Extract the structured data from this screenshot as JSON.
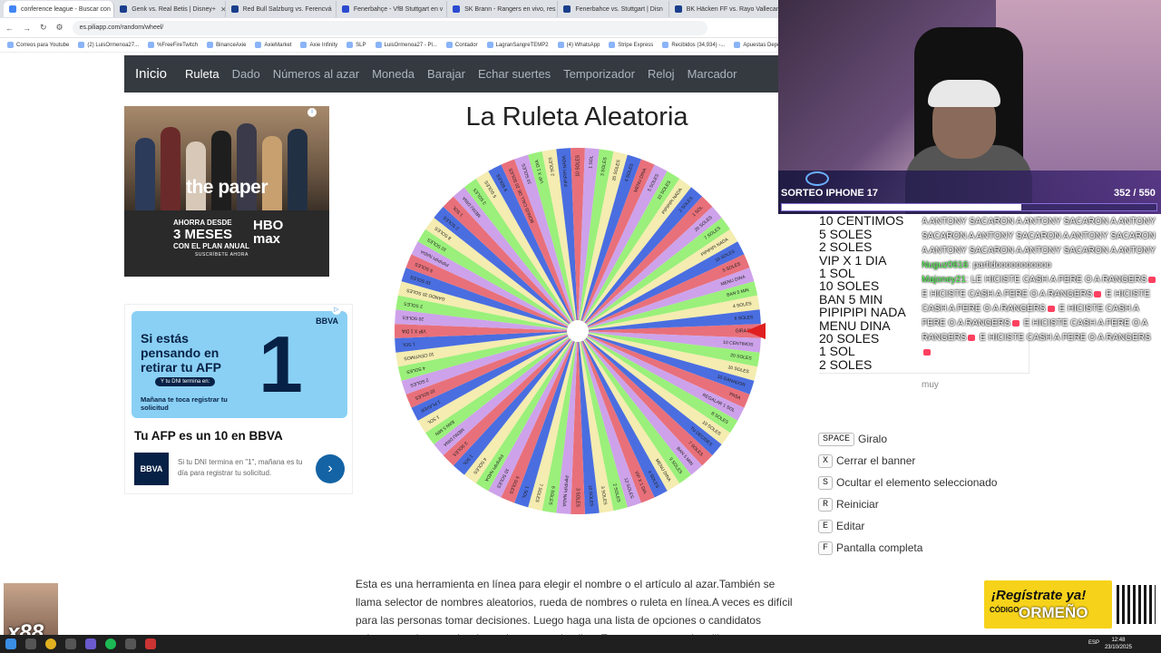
{
  "browser": {
    "tabs": [
      {
        "label": "conference league - Buscar con",
        "color": "#4285f4"
      },
      {
        "label": "Genk vs. Real Betis | Disney+",
        "color": "#1a3e8c"
      },
      {
        "label": "Red Bull Salzburg vs. Ferencvá",
        "color": "#1a3e8c"
      },
      {
        "label": "Fenerbahçe - VfB Stuttgart en v",
        "color": "#2b4ad1"
      },
      {
        "label": "SK Brann - Rangers en vivo, res",
        "color": "#2b4ad1"
      },
      {
        "label": "Fenerbahce vs. Stuttgart | Disn",
        "color": "#1a3e8c"
      },
      {
        "label": "BK Häcken FF vs. Rayo Vallecan",
        "color": "#1a3e8c"
      }
    ],
    "url": "es.piliapp.com/random/wheel/",
    "bookmarks": [
      "Correos para Youtube",
      "(2) LuisOrmenoa27...",
      "%FreeFireTwitch",
      "BinanceAxie",
      "AxieMarket",
      "Axie Infinity",
      "SLP",
      "LuisOrmenoa27 - Pl...",
      "Contador",
      "LagranSangreTEMP2",
      "(4) WhatsApp",
      "Stripe Express",
      "Recibidos (34,934) -...",
      "Apuestas Depo"
    ]
  },
  "nav": {
    "brand": "Inicio",
    "links": [
      "Ruleta",
      "Dado",
      "Números al azar",
      "Moneda",
      "Barajar",
      "Echar suertes",
      "Temporizador",
      "Reloj",
      "Marcador"
    ]
  },
  "ad1": {
    "headline": "the paper",
    "promo_top": "AHORRA DESDE",
    "promo_big": "3 MESES",
    "promo_bottom": "CON EL PLAN ANUAL",
    "brand": "HBO max",
    "cta": "SUSCRÍBETE AHORA"
  },
  "ad2": {
    "brand": "BBVA",
    "headline": "Si estás pensando en retirar tu AFP",
    "dni_pill": "Y tu DNI termina en:",
    "number": "1",
    "sub": "Mañana te toca registrar tu solicitud",
    "title": "Tu AFP es un 10 en BBVA",
    "logo": "BBVA",
    "desc": "Si tu DNI termina en \"1\", mañana es tu día para registrar tu solicitud.",
    "go": "›"
  },
  "wheel": {
    "title": "La Ruleta Aleatoria",
    "colors": [
      "#e8707a",
      "#cda2ea",
      "#9af07a",
      "#f4ecb0",
      "#4a6ee0"
    ],
    "labels": [
      "GIRA DE",
      "10 CENTIMOS",
      "20 SOLES",
      "10 SOLES",
      "10 GANADOR",
      "PASA",
      "REGALAR 1 SOL",
      "8 SOLES",
      "10 SOLES",
      "TU DECIDES",
      "7 SOLES",
      "BAN 5 MIN",
      "9 SOLES",
      "MENU DINA",
      "4 SOLES",
      "VIP X 1 DIA",
      "12 SOLES",
      "2 SOLES",
      "3 SOLES",
      "10 SOLES",
      "3 SOLES",
      "PIPIPIPI NADA",
      "6 SOLES",
      "7 SOLES",
      "1 SOL",
      "5 SOLES",
      "10 SOLES",
      "PIPIPIPI NADA",
      "4 SOLES",
      "1 SOL",
      "3 SOLES",
      "MENU DINA",
      "BAN 5 MIN",
      "1 SOL",
      "1 PLAYER",
      "10 SOLES",
      "2 SOLES",
      "4 SOLES",
      "10 CENTIMOS",
      "1 SOL",
      "VIP X 1 DIA",
      "20 SOLES",
      "2 SOLES",
      "GANDO 20 SOLES",
      "10 SOLES",
      "5 SOLES",
      "PIPIPIPI NADA",
      "10 SOLES",
      "8 SOLES",
      "2 SOLES",
      "1 SOL",
      "MENU DINA",
      "3 SOLES",
      "5 SOLES",
      "9 SOLES",
      "BONUS CALL DE 20 SOLES",
      "10 SOLES",
      "VIP X 1 DIA",
      "2 SOLES",
      "PIPIPIPI NADA",
      "10 SOLES",
      "1 SOL",
      "3 SOLES",
      "20 SOLES",
      "4 SOLES",
      "MENU DINA",
      "5 SOLES",
      "10 SOLES",
      "PIPIPIPI NADA",
      "2 SOLES",
      "1 SOL",
      "20 SOLES",
      "7 SOLES",
      "PIPIPIPI NADA",
      "10 SOLES",
      "5 SOLES",
      "MENU DINA",
      "BAN 5 MIN",
      "4 SOLES",
      "6 SOLES"
    ]
  },
  "options": [
    "1 PLAYER",
    "10 CENTIMOS",
    "5 SOLES",
    "2 SOLES",
    "VIP X 1 DIA",
    "1 SOL",
    "10 SOLES",
    "BAN 5 MIN",
    "PIPIPIPI NADA",
    "MENU DINA",
    "20 SOLES",
    "1 SOL",
    "2 SOLES",
    "PIPIPIPI NADA"
  ],
  "chat": {
    "line1": "A ANTONY SACARON A ANTONY SACARON A ANTONY SACARON A ANTONY SACARON A ANTONY SACARON A ANTONY SACARON A ANTONY SACARON A ANTONY",
    "u2": "Nuguz0616",
    "m2": ": partidooooooooooo",
    "u3": "Majoney21",
    "m3": ": LE HICISTE CASH A FERE O A RANGERS",
    "m3b": "E HICISTE CASH A FERE O A RANGERS",
    "m3c": "E HICISTE CASH A FERE O A RANGERS",
    "m3d": "E HICISTE CASH A FERE O A RANGERS",
    "m3e": "E HICISTE CASH A FERE O A RANGERS",
    "m3f": "E HICISTE CASH A FERE O A RANGERS",
    "tail": "muy"
  },
  "shortcuts": [
    {
      "key": "SPACE",
      "label": "Giralo"
    },
    {
      "key": "X",
      "label": "Cerrar el banner"
    },
    {
      "key": "S",
      "label": "Ocultar el elemento seleccionado"
    },
    {
      "key": "R",
      "label": "Reiniciar"
    },
    {
      "key": "E",
      "label": "Editar"
    },
    {
      "key": "F",
      "label": "Pantalla completa"
    }
  ],
  "description": "Esta es una herramienta en línea para elegir el nombre o el artículo al azar.También se llama selector de nombres aleatorios, rueda de nombres o ruleta en línea.A veces es difícil para las personas tomar decisiones. Luego haga una lista de opciones o candidatos existentes y luego seleccione al azar uno de ellos. En este caso, puede utilizar nuestra herramienta para",
  "stream": {
    "sorteo_title": "SORTEO IPHONE 17",
    "count": "352",
    "total": "/ 550",
    "progress": 0.64,
    "multiplier": "x88"
  },
  "promo": {
    "line1": "¡Regístrate ya!",
    "code_label": "CÓDIGO:",
    "code": "ORMEÑO"
  },
  "taskbar": {
    "lang": "ESP",
    "time": "12:48",
    "date": "23/10/2025"
  }
}
